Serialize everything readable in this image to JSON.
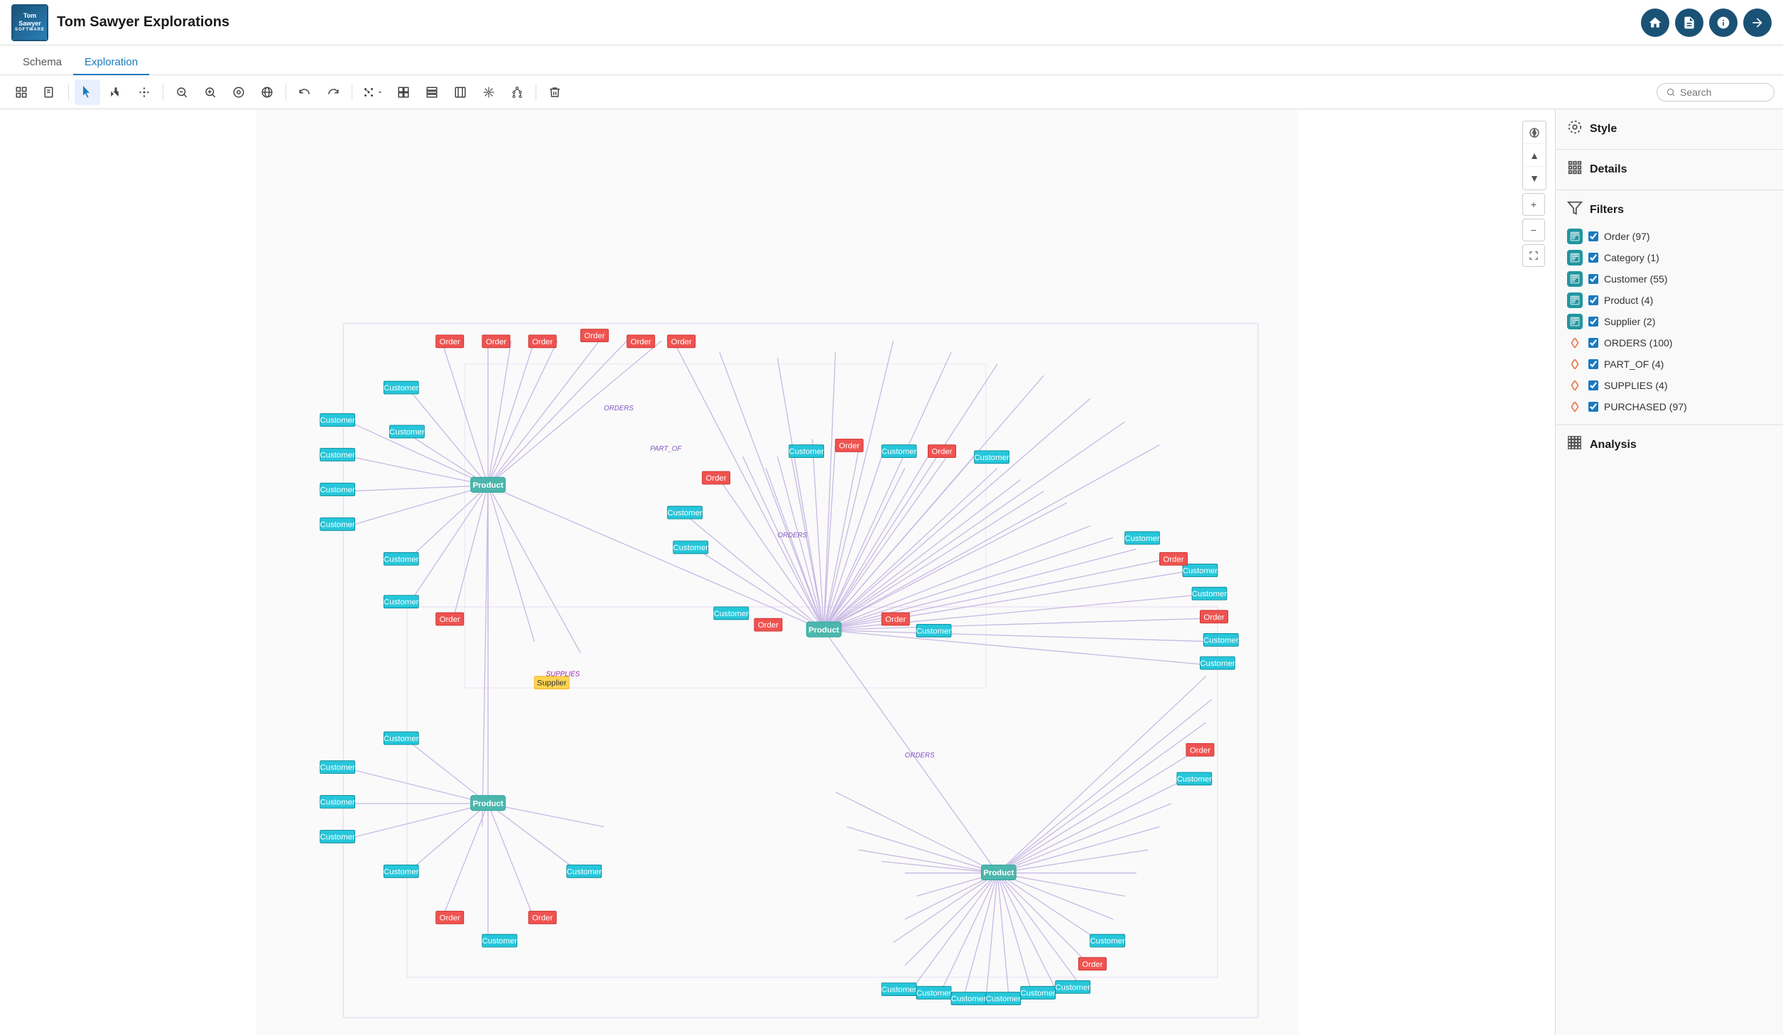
{
  "app": {
    "title": "Tom Sawyer Explorations",
    "logo_line1": "Tom Sawyer",
    "logo_line2": "SOFTWARE"
  },
  "header": {
    "icons": [
      "home",
      "document",
      "info",
      "arrow-right"
    ]
  },
  "tabs": [
    {
      "id": "schema",
      "label": "Schema",
      "active": false
    },
    {
      "id": "exploration",
      "label": "Exploration",
      "active": true
    }
  ],
  "toolbar": {
    "buttons": [
      {
        "id": "select-all",
        "icon": "⊞",
        "title": "Select All"
      },
      {
        "id": "new",
        "icon": "📄",
        "title": "New"
      },
      {
        "id": "pointer",
        "icon": "↖",
        "title": "Pointer",
        "active": true
      },
      {
        "id": "pan",
        "icon": "✋",
        "title": "Pan"
      },
      {
        "id": "move",
        "icon": "✛",
        "title": "Move"
      },
      {
        "id": "zoom-out-rect",
        "icon": "🔍-",
        "title": "Zoom Out Rectangle"
      },
      {
        "id": "zoom-out",
        "icon": "🔍",
        "title": "Zoom Out"
      },
      {
        "id": "zoom-fit",
        "icon": "⊙",
        "title": "Zoom Fit"
      },
      {
        "id": "globe",
        "icon": "🌐",
        "title": "Globe"
      },
      {
        "id": "undo",
        "icon": "↩",
        "title": "Undo"
      },
      {
        "id": "redo",
        "icon": "↪",
        "title": "Redo"
      },
      {
        "id": "layout-drop",
        "icon": "❊",
        "title": "Layout",
        "dropdown": true
      },
      {
        "id": "layout2",
        "icon": "⊞",
        "title": "Layout 2"
      },
      {
        "id": "layout3",
        "icon": "⊟",
        "title": "Layout 3"
      },
      {
        "id": "columns",
        "icon": "⋮⋮",
        "title": "Columns"
      },
      {
        "id": "radial",
        "icon": "✳",
        "title": "Radial"
      },
      {
        "id": "tree",
        "icon": "✼",
        "title": "Tree"
      },
      {
        "id": "delete",
        "icon": "🗑",
        "title": "Delete"
      }
    ],
    "search_placeholder": "Search"
  },
  "canvas": {
    "nav_controls": [
      "compass",
      "plus",
      "minus",
      "fullscreen"
    ]
  },
  "right_panel": {
    "sections": [
      {
        "id": "style",
        "label": "Style",
        "icon": "style"
      },
      {
        "id": "details",
        "label": "Details",
        "icon": "details"
      },
      {
        "id": "filters",
        "label": "Filters",
        "icon": "filter",
        "items": [
          {
            "type": "node",
            "label": "Order (97)",
            "checked": true,
            "color": "#2196a0"
          },
          {
            "type": "node",
            "label": "Category (1)",
            "checked": true,
            "color": "#2196a0"
          },
          {
            "type": "node",
            "label": "Customer (55)",
            "checked": true,
            "color": "#2196a0"
          },
          {
            "type": "node",
            "label": "Product (4)",
            "checked": true,
            "color": "#2196a0"
          },
          {
            "type": "node",
            "label": "Supplier (2)",
            "checked": true,
            "color": "#2196a0"
          },
          {
            "type": "edge",
            "label": "ORDERS (100)",
            "checked": true
          },
          {
            "type": "edge",
            "label": "PART_OF (4)",
            "checked": true
          },
          {
            "type": "edge",
            "label": "SUPPLIES (4)",
            "checked": true
          },
          {
            "type": "edge",
            "label": "PURCHASED (97)",
            "checked": true
          }
        ]
      },
      {
        "id": "analysis",
        "label": "Analysis",
        "icon": "analysis"
      }
    ]
  }
}
